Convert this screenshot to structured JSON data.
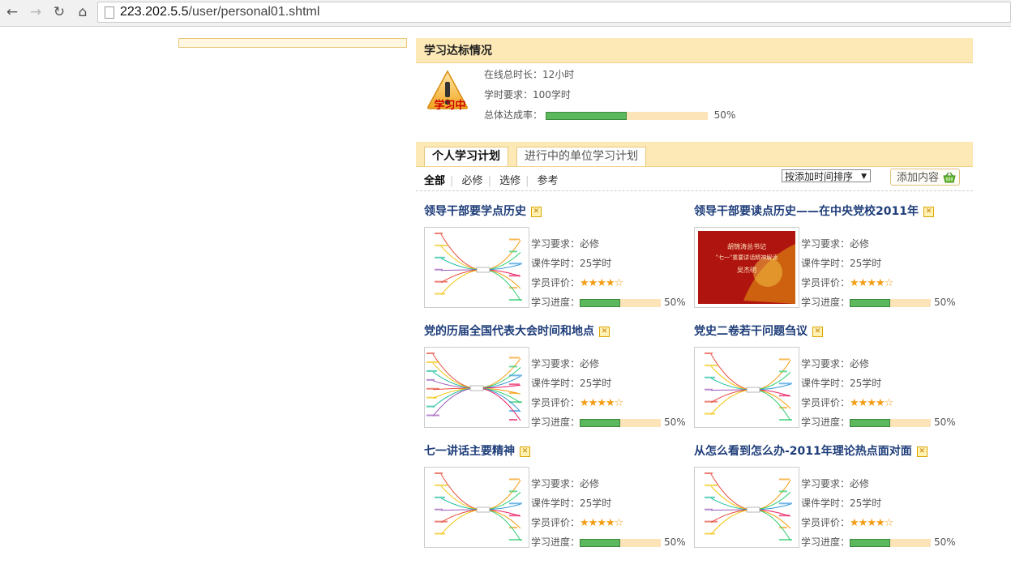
{
  "browser": {
    "url_host": "223.202.5.5",
    "url_path": "/user/personal01.shtml"
  },
  "status": {
    "header": "学习达标情况",
    "badge": "学习中",
    "online_label": "在线总时长：",
    "online_value": "12小时",
    "required_label": "学时要求：",
    "required_value": "100学时",
    "completion_label": "总体达成率：",
    "completion_value": "50%",
    "completion_fraction": 0.5
  },
  "tabs": [
    {
      "label": "个人学习计划",
      "active": true
    },
    {
      "label": "进行中的单位学习计划",
      "active": false
    }
  ],
  "filters": [
    "全部",
    "必修",
    "选修",
    "参考"
  ],
  "sort_label": "按添加时间排序",
  "add_label": "添加内容",
  "labels": {
    "req": "学习要求：",
    "hours": "课件学时：",
    "rating": "学员评价：",
    "progress": "学习进度："
  },
  "courses": [
    {
      "title": "领导干部要学点历史",
      "req": "必修",
      "hours": "25学时",
      "stars": "★★★★☆",
      "rating": 4,
      "progress": "50%",
      "progress_fraction": 0.5
    },
    {
      "title": "领导干部要读点历史——在中央党校2011年",
      "req": "必修",
      "hours": "25学时",
      "stars": "★★★★☆",
      "rating": 4,
      "progress": "50%",
      "progress_fraction": 0.5
    },
    {
      "title": "党的历届全国代表大会时间和地点",
      "req": "必修",
      "hours": "25学时",
      "stars": "★★★★☆",
      "rating": 4,
      "progress": "50%",
      "progress_fraction": 0.5
    },
    {
      "title": "党史二卷若干问题刍议",
      "req": "必修",
      "hours": "25学时",
      "stars": "★★★★☆",
      "rating": 4,
      "progress": "50%",
      "progress_fraction": 0.5
    },
    {
      "title": "七一讲话主要精神",
      "req": "必修",
      "hours": "25学时",
      "stars": "★★★★☆",
      "rating": 4,
      "progress": "50%",
      "progress_fraction": 0.5
    },
    {
      "title": "从怎么看到怎么办-2011年理论热点面对面",
      "req": "必修",
      "hours": "25学时",
      "stars": "★★★★☆",
      "rating": 4,
      "progress": "50%",
      "progress_fraction": 0.5
    }
  ],
  "thumb2_text": {
    "line1": "胡锦涛总书记",
    "line2": "\"七一\"重要讲话精神解读",
    "line3": "吴杰明"
  },
  "colors": {
    "header_bg": "#fde9b5",
    "progress_fill": "#5cb85c",
    "progress_track": "#fde3b8",
    "title_link": "#1e3d7a",
    "star": "#f39c12"
  }
}
